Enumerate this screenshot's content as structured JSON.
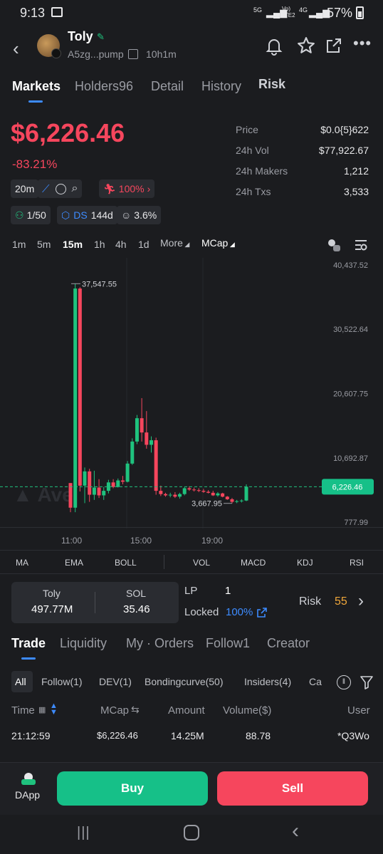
{
  "status": {
    "time": "9:13",
    "network": "5G",
    "lte": "Vo) LTE2",
    "net4g": "4G",
    "battery": "57%"
  },
  "token": {
    "name": "Toly",
    "address": "A5zg...pump",
    "age": "10h1m"
  },
  "tabs": [
    "Markets",
    "Holders96",
    "Detail",
    "History",
    "Risk"
  ],
  "price": {
    "value": "$6,226.46",
    "change": "-83.21%"
  },
  "tags": {
    "interval": "20m",
    "pct": "100%"
  },
  "badges": {
    "holders": "1/50",
    "ds": "DS",
    "ds_age": "144d",
    "pct": "3.6%"
  },
  "stats": [
    {
      "label": "Price",
      "value": "$0.0{5}622"
    },
    {
      "label": "24h Vol",
      "value": "$77,922.67"
    },
    {
      "label": "24h Makers",
      "value": "1,212"
    },
    {
      "label": "24h Txs",
      "value": "3,533"
    }
  ],
  "timeframes": [
    "1m",
    "5m",
    "15m",
    "1h",
    "4h",
    "1d"
  ],
  "tf_more": "More",
  "tf_mcap": "MCap",
  "chart_data": {
    "type": "candlestick",
    "y_ticks": [
      "40,437.52",
      "30,522.64",
      "20,607.75",
      "10,692.87",
      "777.99"
    ],
    "x_ticks": [
      "11:00",
      "15:00",
      "19:00"
    ],
    "high_label": "37,547.55",
    "low_label": "3,667.95",
    "current": "6,226.46",
    "ylim": [
      777.99,
      40437.52
    ],
    "watermark": "Ave"
  },
  "indicators": [
    "MA",
    "EMA",
    "BOLL",
    "VOL",
    "MACD",
    "KDJ",
    "RSI"
  ],
  "pool": {
    "token_label": "Toly",
    "token_amount": "497.77M",
    "sol_label": "SOL",
    "sol_amount": "35.46",
    "lp_label": "LP",
    "lp_value": "1",
    "locked_label": "Locked",
    "locked_value": "100%",
    "risk_label": "Risk",
    "risk_value": "55"
  },
  "trade_tabs": [
    "Trade",
    "Liquidity",
    "My · Orders",
    "Follow1",
    "Creator"
  ],
  "filters": [
    "All",
    "Follow(1)",
    "DEV(1)",
    "Bondingcurve(50)",
    "Insiders(4)",
    "Ca"
  ],
  "table": {
    "headers": [
      "Time",
      "MCap",
      "Amount",
      "Volume($)",
      "User"
    ],
    "rows": [
      [
        "21:12:59",
        "$6,226.46",
        "14.25M",
        "88.78",
        "*Q3Wo"
      ]
    ]
  },
  "bottom": {
    "dapp": "DApp",
    "buy": "Buy",
    "sell": "Sell"
  }
}
